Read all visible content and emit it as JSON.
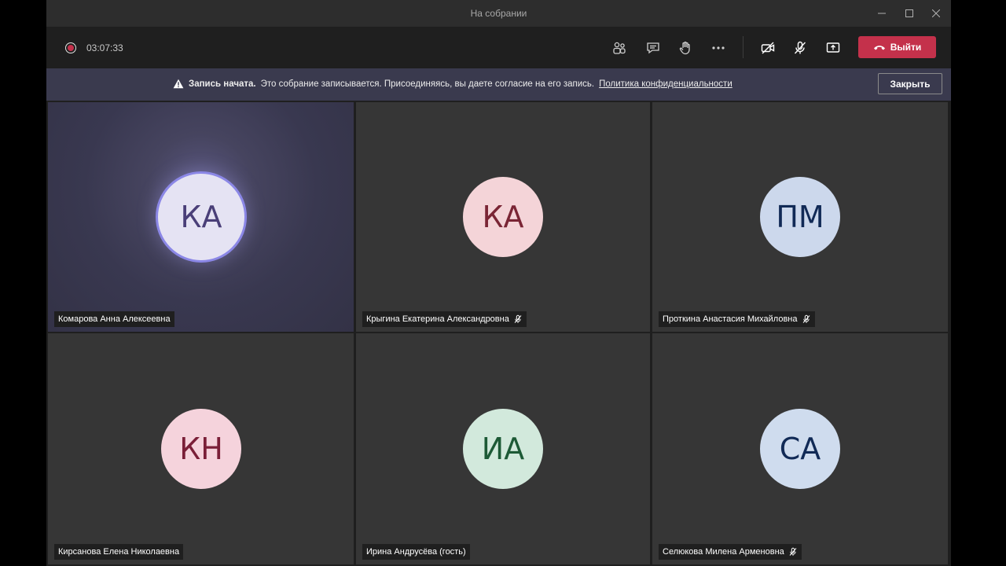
{
  "window": {
    "title": "На собрании"
  },
  "controls": {
    "timer": "03:07:33",
    "leave_label": "Выйти"
  },
  "banner": {
    "bold": "Запись начата.",
    "message": "Это собрание записывается. Присоединяясь, вы даете согласие на его запись.",
    "link": "Политика конфиденциальности",
    "close_label": "Закрыть"
  },
  "participants": [
    {
      "initials": "КА",
      "name": "Комарова Анна Алексеевна",
      "avatar_bg": "#e5e3f3",
      "avatar_fg": "#4a3f78",
      "muted": false,
      "speaking": true
    },
    {
      "initials": "КА",
      "name": "Крыгина Екатерина Александровна",
      "avatar_bg": "#f4d4d8",
      "avatar_fg": "#7a2535",
      "muted": true,
      "speaking": false
    },
    {
      "initials": "ПМ",
      "name": "Проткина Анастасия Михайловна",
      "avatar_bg": "#ccd8ec",
      "avatar_fg": "#112a56",
      "muted": true,
      "speaking": false
    },
    {
      "initials": "КН",
      "name": "Кирсанова Елена Николаевна",
      "avatar_bg": "#f5d3dc",
      "avatar_fg": "#7a1f38",
      "muted": false,
      "speaking": false
    },
    {
      "initials": "ИА",
      "name": "Ирина Андрусёва (гость)",
      "avatar_bg": "#d2e9dc",
      "avatar_fg": "#1d5a36",
      "muted": false,
      "speaking": false
    },
    {
      "initials": "СА",
      "name": "Селюкова Милена Арменовна",
      "avatar_bg": "#cfdcee",
      "avatar_fg": "#112a56",
      "muted": true,
      "speaking": false
    }
  ],
  "colors": {
    "accent": "#c4314b",
    "speaking_ring": "#8b87e6",
    "banner_bg": "#3a3a4e"
  }
}
